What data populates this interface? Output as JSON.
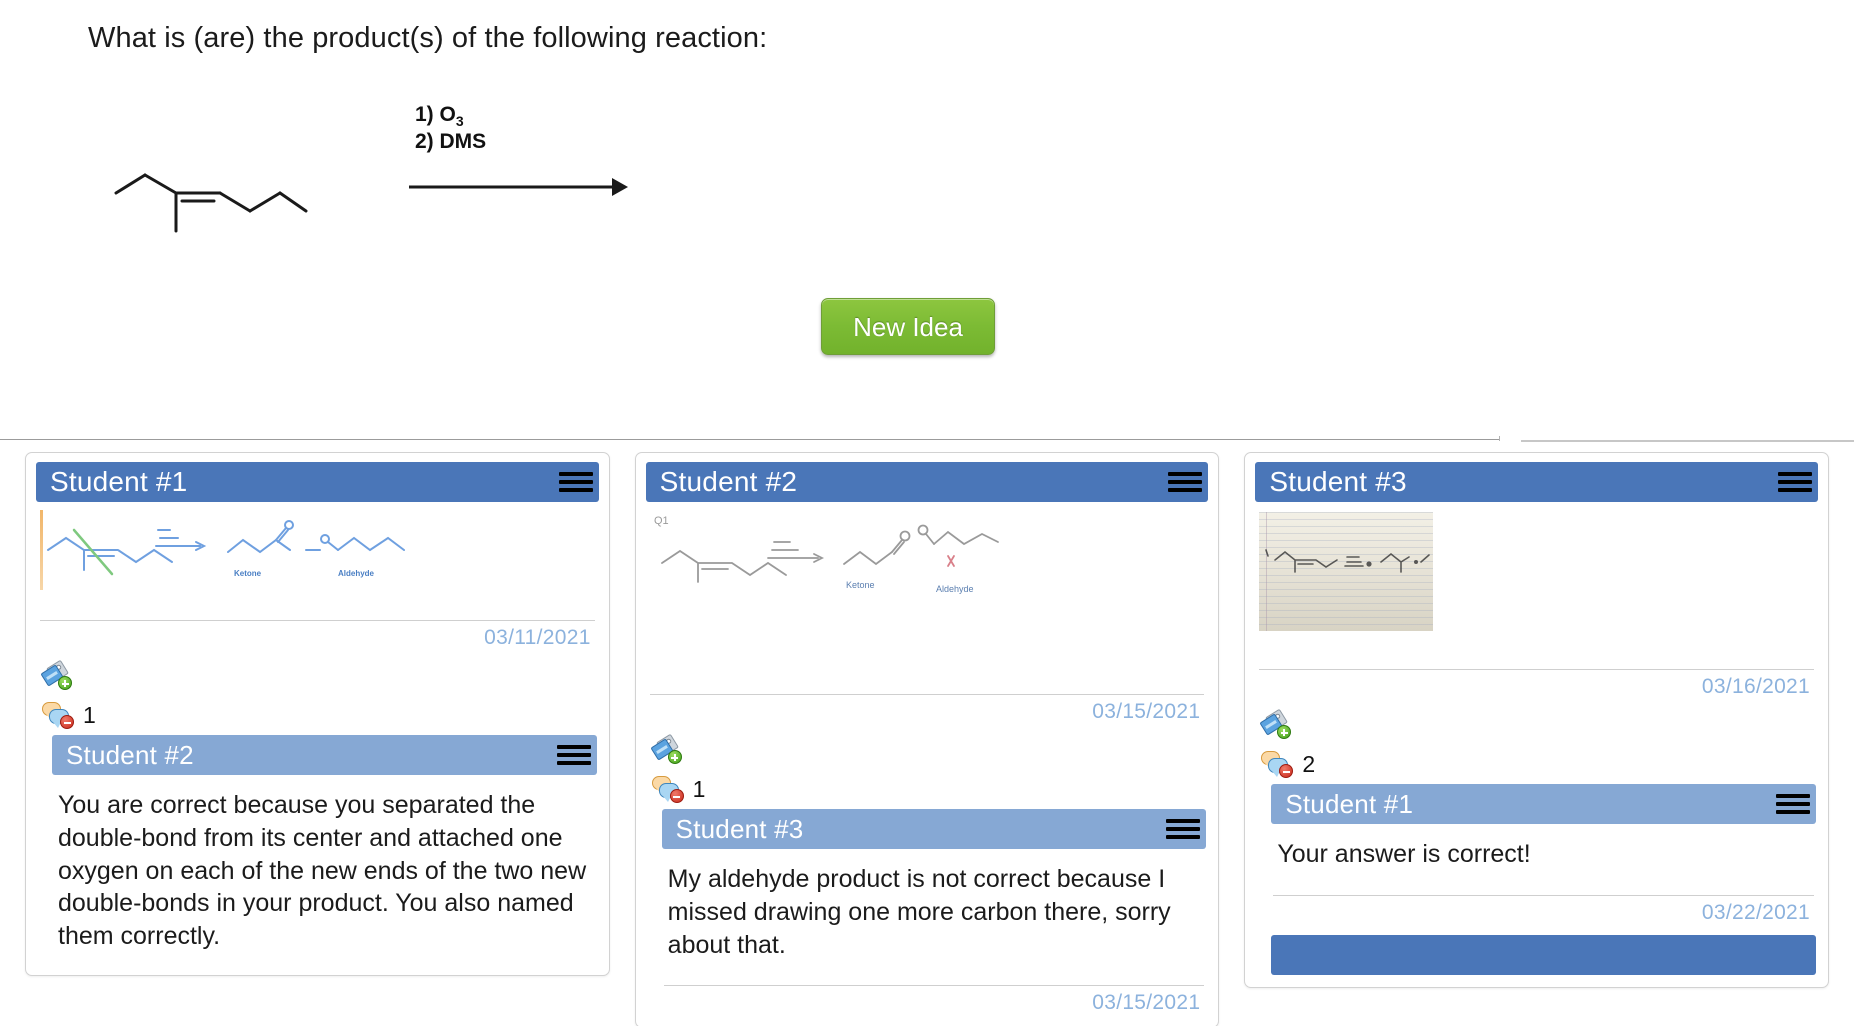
{
  "prompt": {
    "question": "What is (are) the product(s) of the following reaction:",
    "reagent_1": "1) O",
    "reagent_1_sub": "3",
    "reagent_2": "2) DMS",
    "reactant_name": "4-methyl-3-heptene skeletal structure",
    "arrow": "reaction-arrow"
  },
  "new_idea_button": {
    "label": "New Idea",
    "color": "#7cbb34"
  },
  "theme": {
    "header_blue": "#4a76b8",
    "nested_header_blue": "#86a8d4",
    "date_blue": "#8cb2dd"
  },
  "board": {
    "columns": [
      {
        "card": {
          "title": "Student #1",
          "menu_icon": "hamburger-icon",
          "content_type": "sketch",
          "sketch_label": "blue ink ozonolysis reaction sketch with green slash on double bond",
          "date": "03/11/2021",
          "tag_icon": "add-tag-icon",
          "comment_icon": "comment-icon",
          "comment_count": "1",
          "replies": [
            {
              "title": "Student #2",
              "menu_icon": "hamburger-icon",
              "text": "You are correct because you separated the double-bond from its center and attached one oxygen on each of the new ends of the two new double-bonds in your product. You also named them correctly."
            }
          ]
        }
      },
      {
        "card": {
          "title": "Student #2",
          "menu_icon": "hamburger-icon",
          "content_type": "sketch",
          "sketch_label": "Q1 pencil sketch of ozonolysis with Ketone and Aldehyde labels",
          "sketch_caption_q": "Q1",
          "sketch_caption_ketone": "Ketone",
          "sketch_caption_aldehyde": "Aldehyde",
          "date": "03/15/2021",
          "tag_icon": "add-tag-icon",
          "comment_icon": "comment-icon",
          "comment_count": "1",
          "replies": [
            {
              "title": "Student #3",
              "menu_icon": "hamburger-icon",
              "text": "My aldehyde product is not correct because I missed drawing one more carbon there, sorry about that.",
              "date": "03/15/2021"
            }
          ]
        }
      },
      {
        "card": {
          "title": "Student #3",
          "menu_icon": "hamburger-icon",
          "content_type": "photo",
          "sketch_label": "photo of lined notebook paper with pencil drawn reaction",
          "date": "03/16/2021",
          "tag_icon": "add-tag-icon",
          "comment_icon": "comment-icon",
          "comment_count": "2",
          "replies": [
            {
              "title": "Student #1",
              "menu_icon": "hamburger-icon",
              "text": "Your answer is correct!",
              "date": "03/22/2021"
            }
          ]
        }
      }
    ]
  }
}
